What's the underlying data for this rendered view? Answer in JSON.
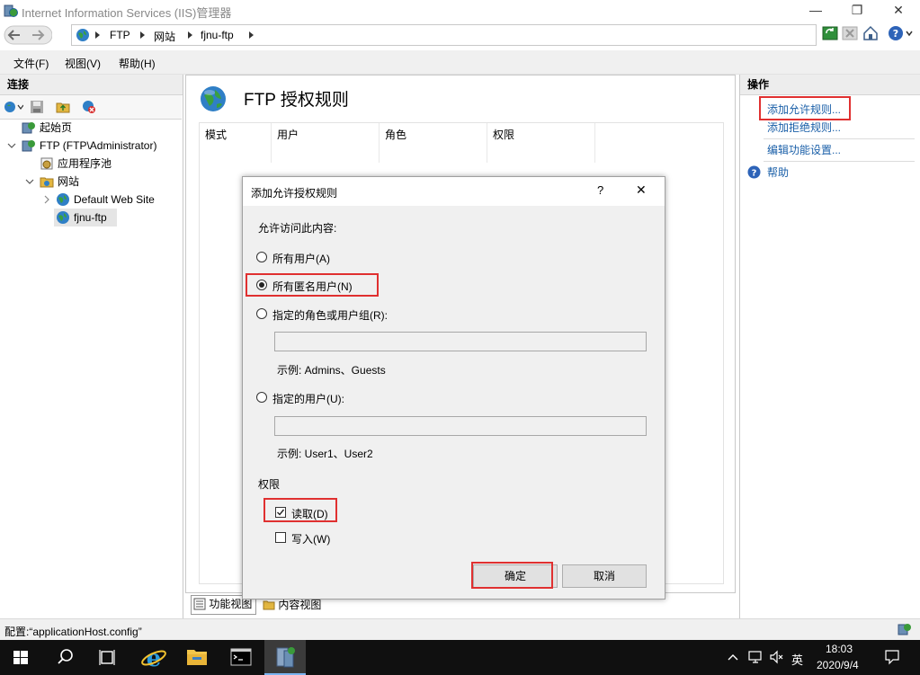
{
  "window": {
    "title": "Internet Information Services (IIS)管理器",
    "min_glyph": "—",
    "max_glyph": "❐",
    "close_glyph": "✕"
  },
  "address": {
    "crumbs": [
      "FTP",
      "网站",
      "fjnu-ftp"
    ]
  },
  "menu": {
    "file": "文件(F)",
    "view": "视图(V)",
    "help": "帮助(H)"
  },
  "connections": {
    "header": "连接",
    "tree": {
      "start_page": "起始页",
      "server": "FTP (FTP\\Administrator)",
      "app_pools": "应用程序池",
      "sites": "网站",
      "default_site": "Default Web Site",
      "ftp_site": "fjnu-ftp"
    }
  },
  "main": {
    "title": "FTP 授权规则",
    "columns": [
      "模式",
      "用户",
      "角色",
      "权限"
    ]
  },
  "view_tabs": {
    "features": "功能视图",
    "content": "内容视图"
  },
  "actions": {
    "header": "操作",
    "add_allow": "添加允许规则...",
    "add_deny": "添加拒绝规则...",
    "edit_settings": "编辑功能设置...",
    "help": "帮助"
  },
  "statusbar": {
    "text": "配置:“applicationHost.config”"
  },
  "taskbar": {
    "time": "18:03",
    "date": "2020/9/4",
    "ime": "英"
  },
  "dialog": {
    "title": "添加允许授权规则",
    "help_glyph": "?",
    "close_glyph": "✕",
    "section_access": "允许访问此内容:",
    "opt_all_users": "所有用户(A)",
    "opt_anonymous": "所有匿名用户(N)",
    "opt_roles": "指定的角色或用户组(R):",
    "roles_value": "",
    "roles_example": "示例: Admins、Guests",
    "opt_users": "指定的用户(U):",
    "users_value": "",
    "users_example": "示例: User1、User2",
    "section_permissions": "权限",
    "perm_read": "读取(D)",
    "perm_write": "写入(W)",
    "ok": "确定",
    "cancel": "取消",
    "selected_option": "anonymous",
    "read_checked": true,
    "write_checked": false
  },
  "colors": {
    "highlight_red": "#e03030",
    "link_blue": "#1a5fa8",
    "taskbar": "#101010"
  }
}
